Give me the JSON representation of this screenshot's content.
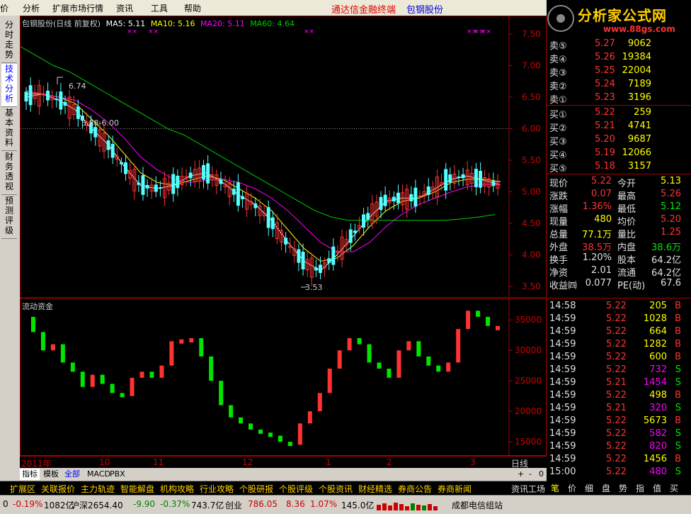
{
  "menu": {
    "items": [
      "分析",
      "扩展市场行情",
      "资讯",
      "工具",
      "帮助"
    ],
    "promo_red": "通达信金融终端",
    "promo_blue": "包钢股份"
  },
  "logo": {
    "title": "分析家公式网",
    "url": "www.88gs.com"
  },
  "lefttabs": [
    "分时走势",
    "技术分析",
    "基本资料",
    "财务透视",
    "预测评级"
  ],
  "chart": {
    "title": "包钢股份(日线 前复权)",
    "ma5": "MA5: 5.11",
    "ma10": "MA10: 5.16",
    "ma20": "MA20: 5.11",
    "ma60": "MA60: 4.64",
    "annot_high": "6.74",
    "annot_line": "5.88-6.00",
    "annot_low": "3.53",
    "sub_title": "流动资金",
    "x_labels": [
      "2011年",
      "10",
      "11",
      "12",
      "1",
      "2",
      "3",
      "日线"
    ]
  },
  "chart_data": [
    {
      "type": "line",
      "title": "包钢股份(日线 前复权)",
      "y_ticks": [
        7.5,
        7.0,
        6.5,
        6.0,
        5.5,
        5.0,
        4.5,
        4.0,
        3.5
      ],
      "ylim": [
        3.4,
        7.6
      ],
      "series": [
        {
          "name": "MA5",
          "values": [
            6.5,
            6.55,
            6.45,
            6.3,
            6.0,
            5.75,
            5.4,
            5.1,
            5.05,
            5.1,
            5.25,
            5.3,
            5.15,
            4.95,
            4.8,
            4.55,
            4.2,
            3.9,
            3.75,
            4.0,
            4.3,
            4.6,
            4.85,
            4.9,
            4.9,
            5.05,
            5.2,
            5.25,
            5.18,
            5.11
          ]
        },
        {
          "name": "MA10",
          "values": [
            6.55,
            6.55,
            6.5,
            6.4,
            6.15,
            5.9,
            5.6,
            5.3,
            5.15,
            5.1,
            5.18,
            5.25,
            5.2,
            5.05,
            4.9,
            4.7,
            4.4,
            4.1,
            3.9,
            3.95,
            4.15,
            4.45,
            4.7,
            4.85,
            4.9,
            5.0,
            5.15,
            5.2,
            5.2,
            5.16
          ]
        },
        {
          "name": "MA20",
          "values": [
            6.6,
            6.55,
            6.5,
            6.45,
            6.3,
            6.1,
            5.85,
            5.55,
            5.35,
            5.2,
            5.15,
            5.18,
            5.2,
            5.15,
            5.05,
            4.9,
            4.7,
            4.45,
            4.2,
            4.05,
            4.05,
            4.2,
            4.45,
            4.65,
            4.8,
            4.9,
            5.0,
            5.08,
            5.12,
            5.11
          ]
        },
        {
          "name": "MA60",
          "values": [
            7.3,
            7.15,
            7.0,
            6.9,
            6.75,
            6.6,
            6.45,
            6.3,
            6.15,
            6.0,
            5.9,
            5.75,
            5.6,
            5.45,
            5.3,
            5.15,
            5.0,
            4.85,
            4.7,
            4.6,
            4.55,
            4.55,
            4.55,
            4.55,
            4.55,
            4.55,
            4.55,
            4.57,
            4.6,
            4.64
          ]
        }
      ]
    },
    {
      "type": "line",
      "title": "流动资金",
      "y_ticks": [
        35000,
        30000,
        25000,
        20000,
        15000
      ],
      "ylim": [
        13500,
        37000
      ],
      "series": [
        {
          "name": "流动资金",
          "values": [
            35500,
            33000,
            30000,
            31000,
            28000,
            26500,
            24000,
            26000,
            24500,
            23000,
            22500,
            25500,
            26500,
            25500,
            27500,
            31500,
            31800,
            32000,
            29000,
            25000,
            21000,
            19000,
            18000,
            17000,
            16500,
            16000,
            15000,
            14500,
            18000,
            20000,
            23000,
            27000,
            30000,
            32000,
            31000,
            28000,
            27000,
            25500,
            30000,
            31500,
            29000,
            27500,
            26500,
            28000,
            33500,
            36500,
            35500,
            34000,
            34000
          ]
        }
      ]
    }
  ],
  "quotes": {
    "asks": [
      {
        "label": "卖⑤",
        "price": "5.27",
        "vol": "9062"
      },
      {
        "label": "卖④",
        "price": "5.26",
        "vol": "19384"
      },
      {
        "label": "卖③",
        "price": "5.25",
        "vol": "22004"
      },
      {
        "label": "卖②",
        "price": "5.24",
        "vol": "7189"
      },
      {
        "label": "卖①",
        "price": "5.23",
        "vol": "3196"
      }
    ],
    "bids": [
      {
        "label": "买①",
        "price": "5.22",
        "vol": "259"
      },
      {
        "label": "买②",
        "price": "5.21",
        "vol": "4741"
      },
      {
        "label": "买③",
        "price": "5.20",
        "vol": "9687"
      },
      {
        "label": "买④",
        "price": "5.19",
        "vol": "12066"
      },
      {
        "label": "买⑤",
        "price": "5.18",
        "vol": "3157"
      }
    ],
    "stats": [
      {
        "l1": "现价",
        "v1": "5.22",
        "c1": "red",
        "l2": "今开",
        "v2": "5.13",
        "c2": "yellow"
      },
      {
        "l1": "涨跌",
        "v1": "0.07",
        "c1": "red",
        "l2": "最高",
        "v2": "5.26",
        "c2": "red"
      },
      {
        "l1": "涨幅",
        "v1": "1.36%",
        "c1": "red",
        "l2": "最低",
        "v2": "5.12",
        "c2": "green"
      },
      {
        "l1": "现量",
        "v1": "480",
        "c1": "yellow",
        "l2": "均价",
        "v2": "5.20",
        "c2": "red"
      },
      {
        "l1": "总量",
        "v1": "77.1万",
        "c1": "yellow",
        "l2": "量比",
        "v2": "1.25",
        "c2": "red"
      },
      {
        "l1": "外盘",
        "v1": "38.5万",
        "c1": "red",
        "l2": "内盘",
        "v2": "38.6万",
        "c2": "green"
      },
      {
        "l1": "换手",
        "v1": "1.20%",
        "c1": "white",
        "l2": "股本",
        "v2": "64.2亿",
        "c2": "white"
      },
      {
        "l1": "净资",
        "v1": "2.01",
        "c1": "white",
        "l2": "流通",
        "v2": "64.2亿",
        "c2": "white"
      },
      {
        "l1": "收益㈣",
        "v1": "0.077",
        "c1": "white",
        "l2": "PE(动)",
        "v2": "67.6",
        "c2": "white"
      }
    ],
    "ticks": [
      {
        "t": "14:58",
        "p": "5.22",
        "v": "205",
        "d": "B"
      },
      {
        "t": "14:59",
        "p": "5.22",
        "v": "1028",
        "d": "B"
      },
      {
        "t": "14:59",
        "p": "5.22",
        "v": "664",
        "d": "B"
      },
      {
        "t": "14:59",
        "p": "5.22",
        "v": "1282",
        "d": "B"
      },
      {
        "t": "14:59",
        "p": "5.22",
        "v": "600",
        "d": "B"
      },
      {
        "t": "14:59",
        "p": "5.22",
        "v": "732",
        "d": "S"
      },
      {
        "t": "14:59",
        "p": "5.21",
        "v": "1454",
        "d": "S"
      },
      {
        "t": "14:59",
        "p": "5.22",
        "v": "498",
        "d": "B"
      },
      {
        "t": "14:59",
        "p": "5.21",
        "v": "320",
        "d": "S"
      },
      {
        "t": "14:59",
        "p": "5.22",
        "v": "5673",
        "d": "B"
      },
      {
        "t": "14:59",
        "p": "5.22",
        "v": "582",
        "d": "S"
      },
      {
        "t": "14:59",
        "p": "5.22",
        "v": "820",
        "d": "S"
      },
      {
        "t": "14:59",
        "p": "5.22",
        "v": "1456",
        "d": "B"
      },
      {
        "t": "15:00",
        "p": "5.22",
        "v": "480",
        "d": "S"
      }
    ]
  },
  "bottomtabs": [
    "指标",
    "模板",
    "全部",
    "MACD",
    "PBX"
  ],
  "toolbar": [
    "扩展区",
    "关联报价",
    "主力轨迹",
    "智能解盘",
    "机构攻略",
    "行业攻略",
    "个股研报",
    "个股评级",
    "个股资讯",
    "财经精选",
    "券商公告",
    "券商新闻",
    "资讯工场"
  ],
  "righttabs": [
    "笔",
    "价",
    "细",
    "盘",
    "势",
    "指",
    "值",
    "买"
  ],
  "status": {
    "s1": "-0.19%",
    "s2": "1082亿",
    "s3": "沪深2654.40",
    "s4": "-9.90",
    "s5": "-0.37%",
    "s6": "743.7亿",
    "s7": "创业",
    "s8": "786.05",
    "s9": "8.36",
    "s10": "1.07%",
    "s11": "145.0亿",
    "s12": "成都电信组站"
  },
  "colors": {
    "up": "#ff3232",
    "down": "#00e600",
    "ma5": "#ffffff",
    "ma10": "#ffff00",
    "ma20": "#ff00ff",
    "ma60": "#00cc00"
  }
}
